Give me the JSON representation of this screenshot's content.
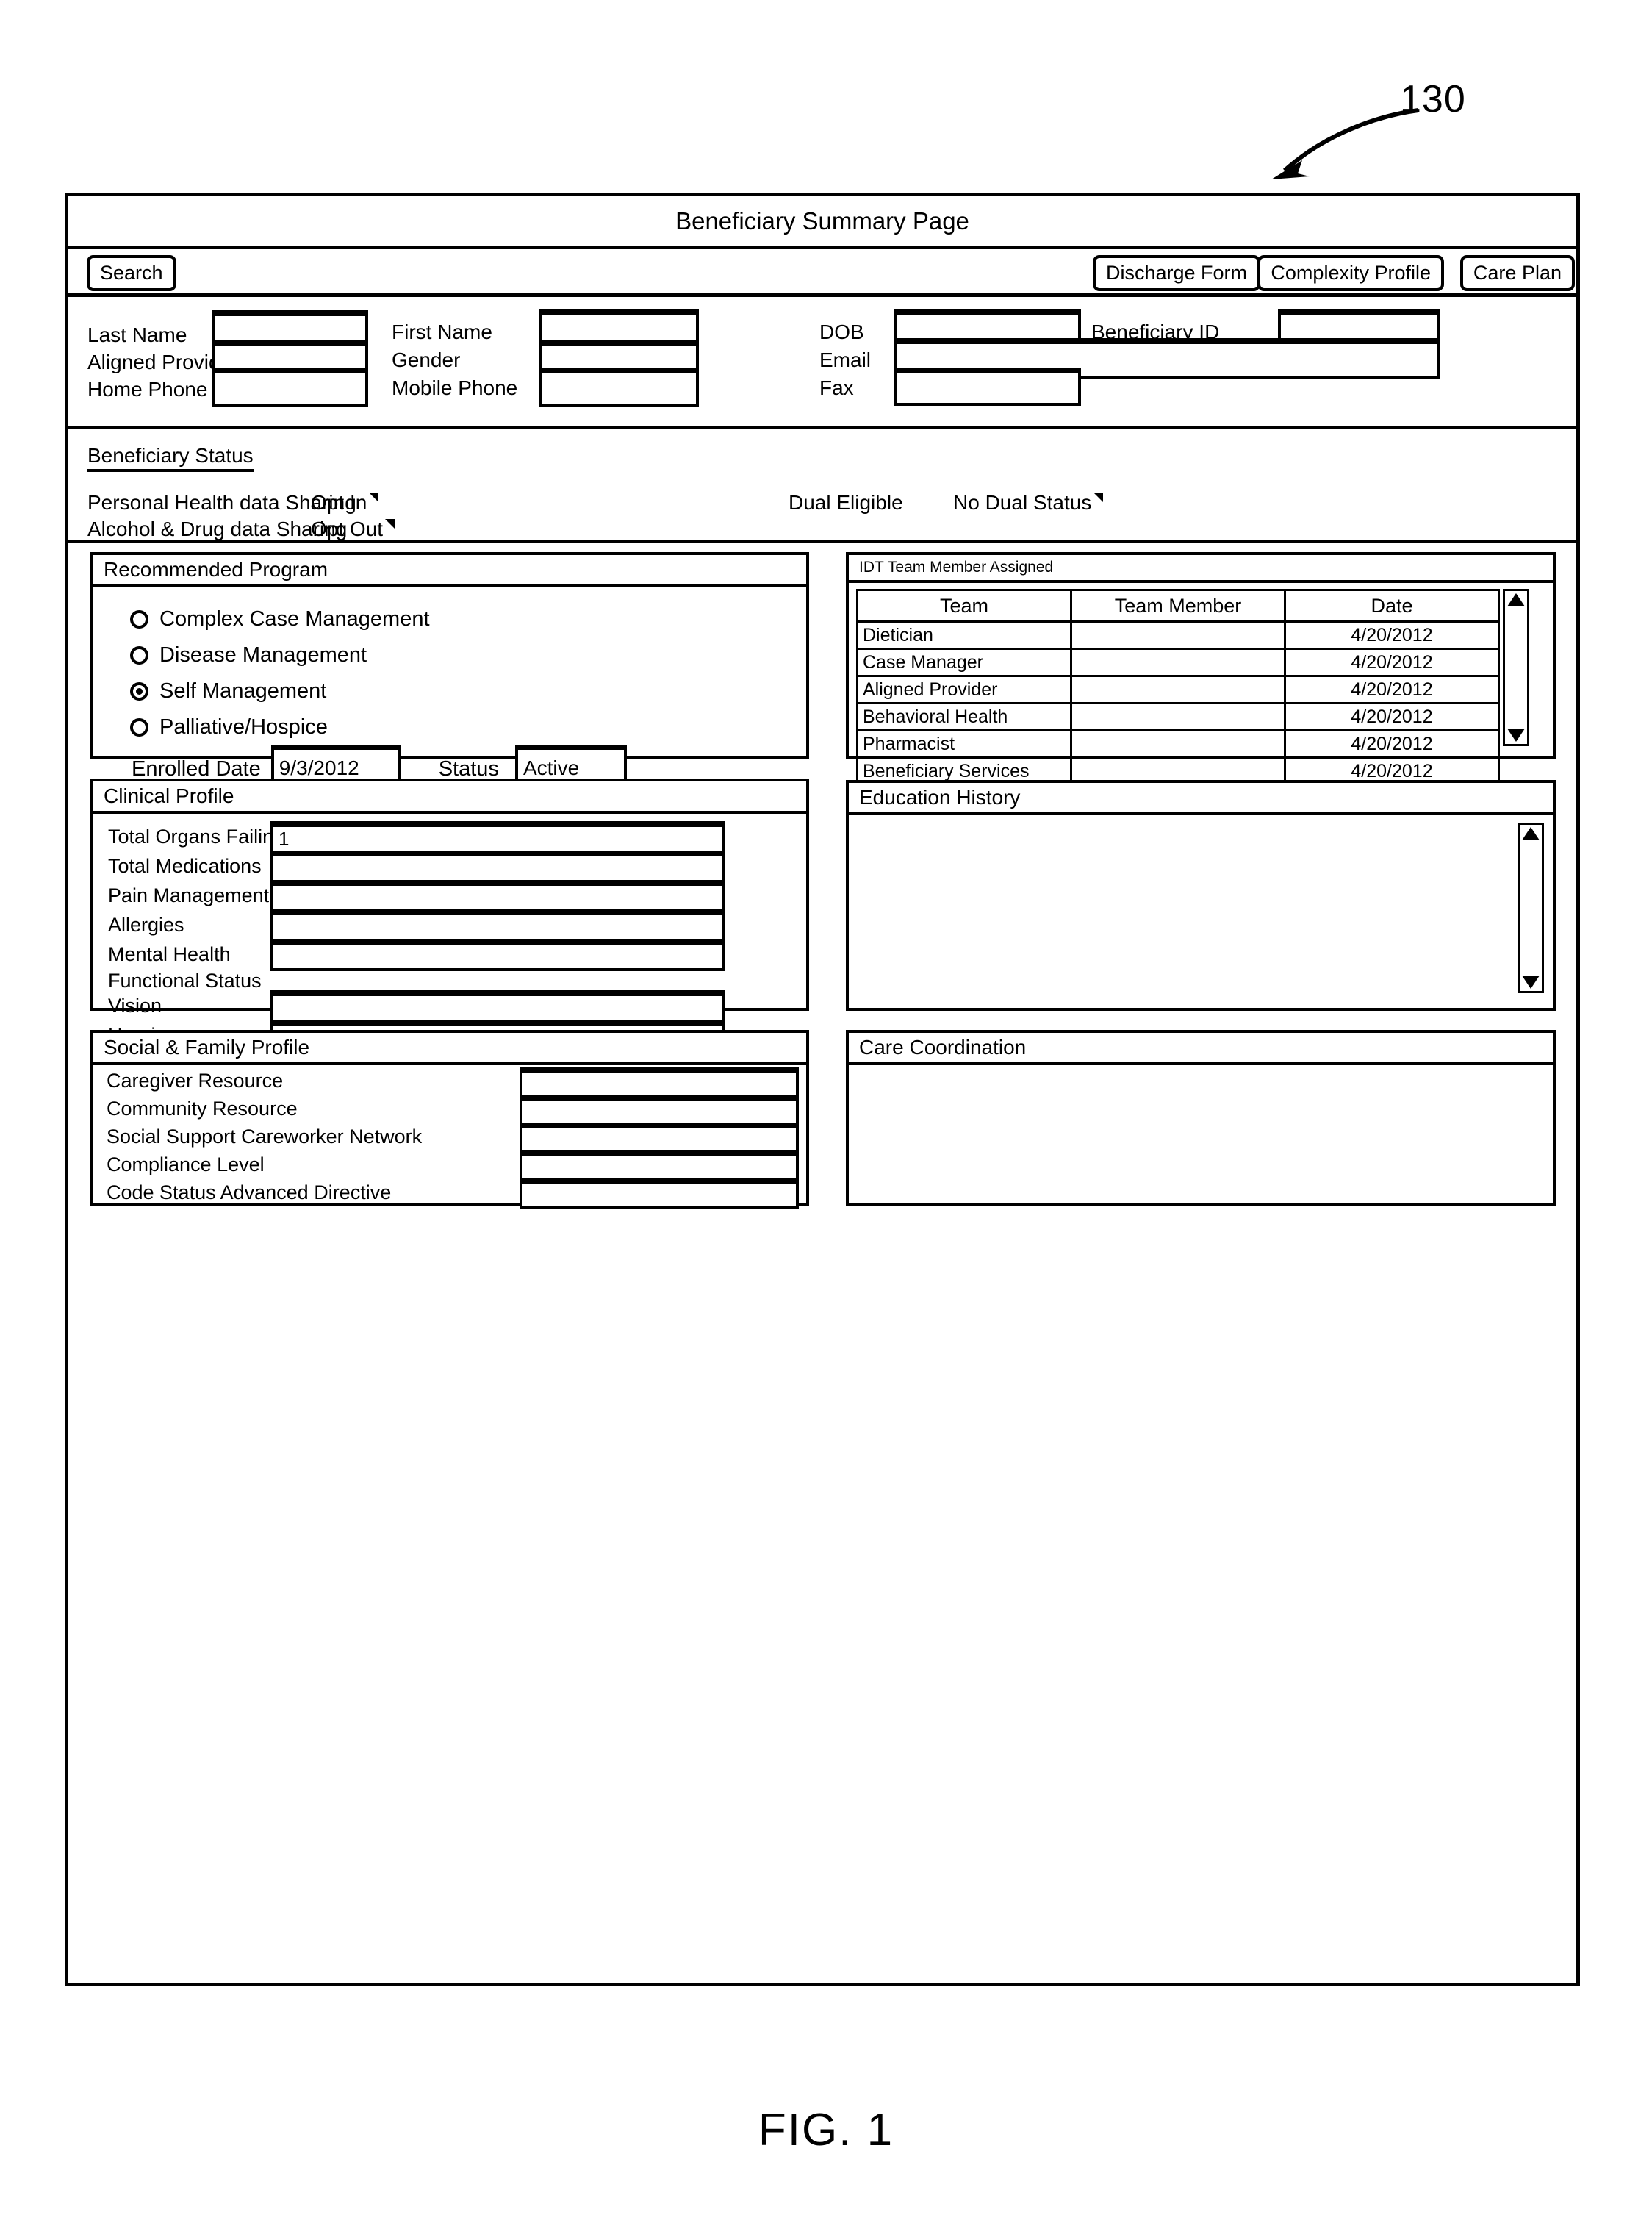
{
  "figure": {
    "reference_numeral": "130",
    "caption": "FIG. 1"
  },
  "window": {
    "title": "Beneficiary Summary Page"
  },
  "toolbar": {
    "search_label": "Search",
    "discharge_form_label": "Discharge Form",
    "complexity_profile_label": "Complexity Profile",
    "care_plan_label": "Care Plan"
  },
  "demographics": {
    "last_name_label": "Last Name",
    "last_name_value": "",
    "first_name_label": "First Name",
    "first_name_value": "",
    "dob_label": "DOB",
    "dob_value": "",
    "beneficiary_id_label": "Beneficiary ID",
    "beneficiary_id_value": "",
    "aligned_provider_label": "Aligned Provider",
    "aligned_provider_value": "",
    "gender_label": "Gender",
    "gender_value": "",
    "email_label": "Email",
    "email_value": "",
    "home_phone_label": "Home Phone",
    "home_phone_value": "",
    "mobile_phone_label": "Mobile Phone",
    "mobile_phone_value": "",
    "fax_label": "Fax",
    "fax_value": ""
  },
  "beneficiary_status": {
    "heading": "Beneficiary Status",
    "personal_health_label": "Personal Health data Sharing",
    "personal_health_value": "Opt In",
    "alcohol_drug_label": "Alcohol & Drug data Sharing",
    "alcohol_drug_value": "Opt Out",
    "dual_eligible_label": "Dual Eligible",
    "dual_eligible_value": "No Dual Status"
  },
  "recommended_program": {
    "title": "Recommended Program",
    "options": [
      {
        "label": "Complex Case Management",
        "selected": false
      },
      {
        "label": "Disease Management",
        "selected": false
      },
      {
        "label": "Self Management",
        "selected": true
      },
      {
        "label": "Palliative/Hospice",
        "selected": false
      }
    ],
    "enrolled_date_label": "Enrolled Date",
    "enrolled_date_value": "9/3/2012",
    "status_label": "Status",
    "status_value": "Active"
  },
  "idt_team": {
    "title": "IDT Team Member Assigned",
    "columns": [
      "Team",
      "Team Member",
      "Date"
    ],
    "rows": [
      {
        "team": "Dietician",
        "member": "",
        "date": "4/20/2012"
      },
      {
        "team": "Case Manager",
        "member": "",
        "date": "4/20/2012"
      },
      {
        "team": "Aligned Provider",
        "member": "",
        "date": "4/20/2012"
      },
      {
        "team": "Behavioral Health",
        "member": "",
        "date": "4/20/2012"
      },
      {
        "team": "Pharmacist",
        "member": "",
        "date": "4/20/2012"
      },
      {
        "team": "Beneficiary Services",
        "member": "",
        "date": "4/20/2012"
      }
    ]
  },
  "clinical_profile": {
    "title": "Clinical Profile",
    "total_organs_failing_label": "Total Organs Failing",
    "total_organs_failing_value": "1",
    "total_medications_label": "Total Medications",
    "total_medications_value": "",
    "pain_management_label": "Pain Management",
    "pain_management_value": "",
    "allergies_label": "Allergies",
    "allergies_value": "",
    "mental_health_label": "Mental Health",
    "mental_health_value": "",
    "functional_status_label": "Functional Status",
    "vision_label": "Vision",
    "vision_value": "",
    "hearing_label": "Hearing",
    "hearing_value": ""
  },
  "education_history": {
    "title": "Education History",
    "content": ""
  },
  "social_family_profile": {
    "title": "Social & Family Profile",
    "caregiver_resource_label": "Caregiver Resource",
    "caregiver_resource_value": "",
    "community_resource_label": "Community Resource",
    "community_resource_value": "",
    "social_support_label": "Social Support Careworker Network",
    "social_support_value": "",
    "compliance_level_label": "Compliance Level",
    "compliance_level_value": "",
    "code_status_label": "Code Status Advanced Directive",
    "code_status_value": ""
  },
  "care_coordination": {
    "title": "Care Coordination",
    "content": ""
  }
}
